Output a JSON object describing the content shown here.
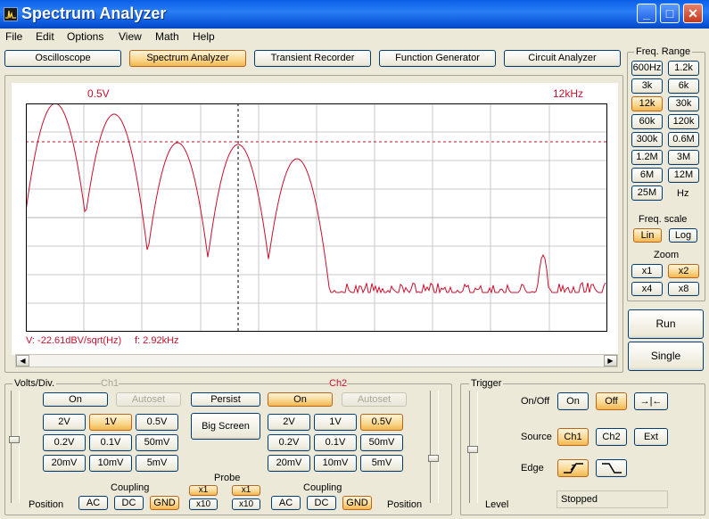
{
  "window": {
    "title": "Spectrum Analyzer"
  },
  "menu": [
    "File",
    "Edit",
    "Options",
    "View",
    "Math",
    "Help"
  ],
  "tabs": [
    "Oscilloscope",
    "Spectrum Analyzer",
    "Transient Recorder",
    "Function Generator",
    "Circuit Analyzer"
  ],
  "screen": {
    "top_left": "0.5V",
    "top_right": "12kHz",
    "readout_v": "V: -22.61dBV/sqrt(Hz)",
    "readout_f": "f: 2.92kHz"
  },
  "freq": {
    "title": "Freq. Range",
    "ranges": [
      "600Hz",
      "1.2k",
      "3k",
      "6k",
      "12k",
      "30k",
      "60k",
      "120k",
      "300k",
      "0.6M",
      "1.2M",
      "3M",
      "6M",
      "12M",
      "25M"
    ],
    "unit": "Hz",
    "scale_title": "Freq. scale",
    "lin": "Lin",
    "log": "Log",
    "zoom_title": "Zoom",
    "zoom": [
      "x1",
      "x2",
      "x4",
      "x8"
    ]
  },
  "run": {
    "run": "Run",
    "single": "Single"
  },
  "volts": {
    "title": "Volts/Div.",
    "ch1": "Ch1",
    "ch2": "Ch2",
    "on": "On",
    "autoset": "Autoset",
    "persist": "Persist",
    "big_screen": "Big Screen",
    "scales": [
      "2V",
      "1V",
      "0.5V",
      "0.2V",
      "0.1V",
      "50mV",
      "20mV",
      "10mV",
      "5mV"
    ],
    "coupling": "Coupling",
    "ac": "AC",
    "dc": "DC",
    "gnd": "GND",
    "probe": "Probe",
    "x1": "x1",
    "x10": "x10",
    "position": "Position"
  },
  "trigger": {
    "title": "Trigger",
    "onoff": "On/Off",
    "on": "On",
    "off": "Off",
    "source": "Source",
    "ch1": "Ch1",
    "ch2": "Ch2",
    "ext": "Ext",
    "edge": "Edge",
    "level": "Level",
    "status": "Stopped"
  },
  "colors": {
    "trace": "#c8102e",
    "accent": "#f2b750",
    "titlebar": "#0a5fe8"
  }
}
